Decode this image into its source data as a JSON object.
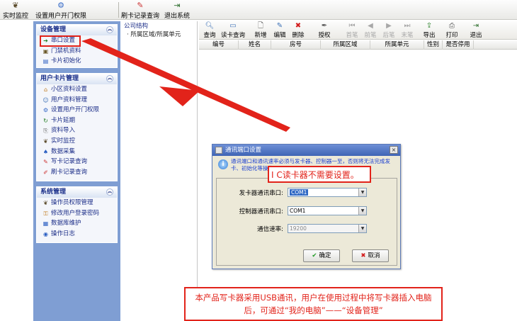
{
  "toolbar": {
    "items": [
      {
        "label": "实时监控",
        "icon": "monitor-icon"
      },
      {
        "label": "设置用户开门权限",
        "icon": "door-permission-icon"
      },
      {
        "label": "刷卡记录查询",
        "icon": "card-record-icon"
      },
      {
        "label": "退出系统",
        "icon": "exit-icon"
      }
    ]
  },
  "sidebar": {
    "device": {
      "title": "设备管理",
      "items": [
        "串口设置",
        "门禁机资料",
        "卡片初始化"
      ]
    },
    "users": {
      "title": "用户卡片管理",
      "items": [
        "小区资料设置",
        "用户资料管理",
        "设置用户开门权限",
        "卡片延期",
        "资料导入",
        "实时监控",
        "数据采集",
        "写卡记录查询",
        "刷卡记录查询"
      ]
    },
    "system": {
      "title": "系统管理",
      "items": [
        "操作员权限管理",
        "修改用户登录密码",
        "数据库维护",
        "操作日志"
      ]
    }
  },
  "tree": {
    "root": "公司结构",
    "child": "所属区域/所属单元"
  },
  "right_toolbar": {
    "buttons": [
      "查询",
      "读卡查询",
      "新增",
      "编辑",
      "删除",
      "授权",
      "首笔",
      "前笔",
      "后笔",
      "末笔",
      "导出",
      "打印",
      "退出"
    ]
  },
  "table": {
    "columns": [
      "编号",
      "姓名",
      "房号",
      "所属区域",
      "所属单元",
      "性别",
      "是否停用"
    ]
  },
  "dialog": {
    "title": "通讯端口设置",
    "note": "通讯端口和通讯速率必须与发卡器、控制器一至，否则将无法完成发卡、初始化等操作。",
    "fields": [
      {
        "label": "发卡器通讯串口:",
        "value": "COM1"
      },
      {
        "label": "控制器通讯串口:",
        "value": "COM1"
      },
      {
        "label": "通信速率:",
        "value": "19200"
      }
    ],
    "ok_label": "确定",
    "cancel_label": "取消"
  },
  "annotations": {
    "ic_note": "I C读卡器不需要设置。",
    "usb_note": "本产品写卡器采用USB通讯，用户在使用过程中将写卡器插入电脑后，可通过“我的电脑”——“设备管理”"
  },
  "colors": {
    "sidebar_bg": "#7f9ed3",
    "annotation_red": "#e2231a",
    "dialog_title": "#3f64b5",
    "note_blue": "#1b3fd0"
  }
}
